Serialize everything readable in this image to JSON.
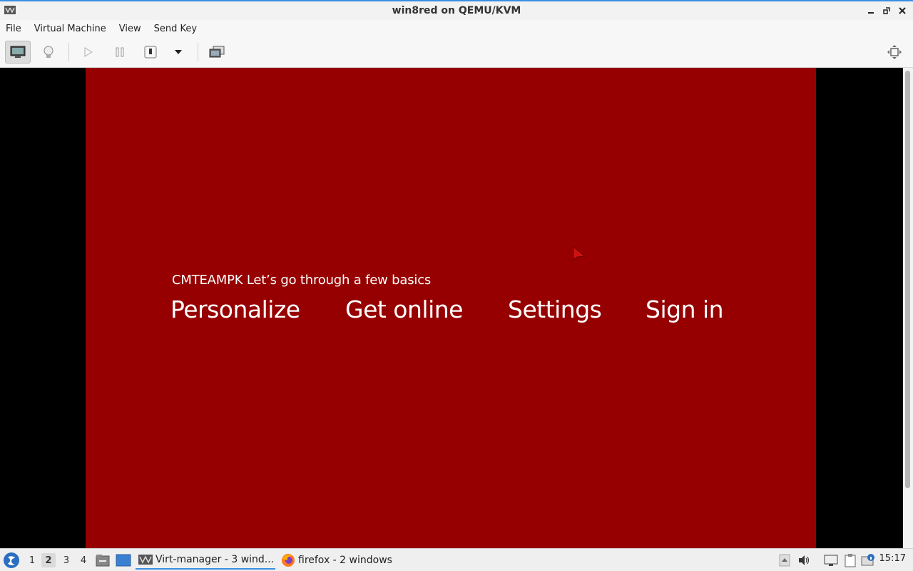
{
  "window": {
    "title": "win8red on QEMU/KVM"
  },
  "menu": [
    "File",
    "Virtual Machine",
    "View",
    "Send Key"
  ],
  "guest": {
    "subtitle": "CMTEAMPK Let’s go through a few basics",
    "steps": [
      "Personalize",
      "Get online",
      "Settings",
      "Sign in"
    ],
    "background": "#960000"
  },
  "taskbar": {
    "workspaces": [
      "1",
      "2",
      "3",
      "4"
    ],
    "active_workspace": "2",
    "tasks": [
      {
        "label": "Virt-manager - 3 wind..."
      },
      {
        "label": "firefox - 2 windows"
      }
    ],
    "clock": "15:17"
  },
  "colors": {
    "accent": "#3b8ee0",
    "vm_bg": "#960000"
  }
}
